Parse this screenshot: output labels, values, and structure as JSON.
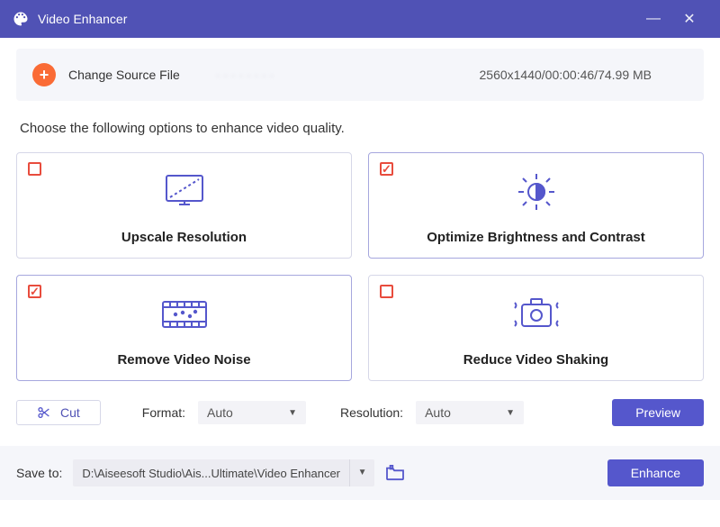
{
  "titlebar": {
    "title": "Video Enhancer"
  },
  "source": {
    "change_label": "Change Source File",
    "filename_blur": "· · · · · · · ·",
    "meta": "2560x1440/00:00:46/74.99 MB"
  },
  "instruction": "Choose the following options to enhance video quality.",
  "cards": {
    "upscale": {
      "label": "Upscale Resolution",
      "checked": false
    },
    "brightness": {
      "label": "Optimize Brightness and Contrast",
      "checked": true
    },
    "noise": {
      "label": "Remove Video Noise",
      "checked": true
    },
    "shaking": {
      "label": "Reduce Video Shaking",
      "checked": false
    }
  },
  "controls": {
    "cut_label": "Cut",
    "format_label": "Format:",
    "format_value": "Auto",
    "resolution_label": "Resolution:",
    "resolution_value": "Auto",
    "preview_label": "Preview"
  },
  "footer": {
    "save_label": "Save to:",
    "path": "D:\\Aiseesoft Studio\\Ais...Ultimate\\Video Enhancer",
    "enhance_label": "Enhance"
  },
  "colors": {
    "accent": "#5557cc",
    "titlebar": "#5052b5",
    "orange": "#fa6b35",
    "checkred": "#e84c3d"
  }
}
